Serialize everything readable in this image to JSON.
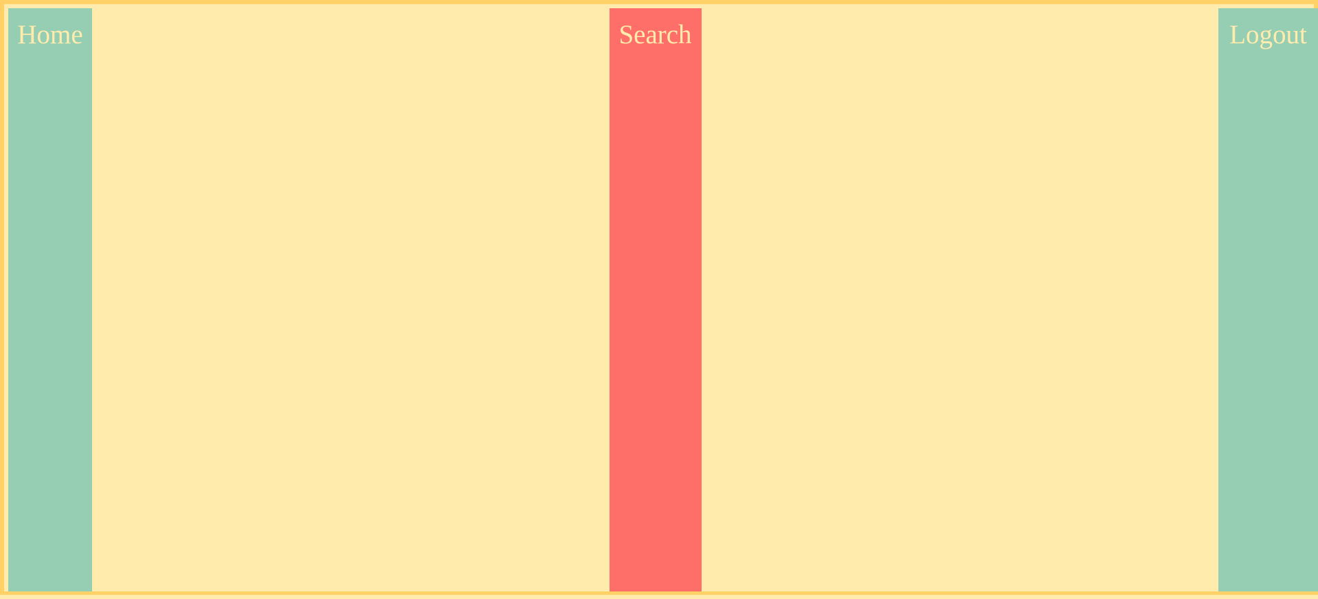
{
  "nav": {
    "items": [
      {
        "label": "Home"
      },
      {
        "label": "Search"
      },
      {
        "label": "Logout"
      }
    ],
    "active_index": 1
  },
  "colors": {
    "page_background": "#ffecad",
    "border": "#ffd166",
    "nav_item_default": "#96ceb4",
    "nav_item_active": "#ff6f69",
    "nav_text": "#ffecad"
  }
}
